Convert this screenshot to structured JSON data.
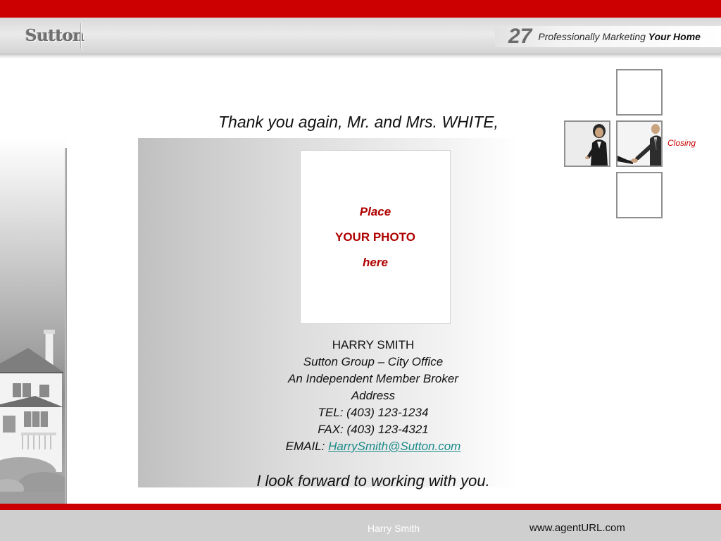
{
  "header": {
    "logo_text": "Sutton",
    "tagline_number": "27",
    "tagline_text": "Professionally Marketing",
    "tagline_bold": "Your Home"
  },
  "slide": {
    "greeting": "Thank you again, Mr. and Mrs. WHITE,",
    "photo_placeholder": {
      "line1": "Place",
      "line2": "YOUR PHOTO",
      "line3": "here"
    },
    "agent": {
      "name": "HARRY SMITH",
      "company": "Sutton Group – City Office",
      "broker": "An Independent Member Broker",
      "address": "Address",
      "tel": "TEL: (403) 123-1234",
      "fax": "FAX: (403) 123-4321",
      "email_label": "EMAIL: ",
      "email": "HarrySmith@Sutton.com"
    },
    "closing": "I look forward to working with you."
  },
  "process_graphic": {
    "step_label": "Closing"
  },
  "footer": {
    "agent_name": "Harry Smith",
    "url": "www.agentURL.com"
  },
  "colors": {
    "brand_red": "#cc0000",
    "placeholder_red": "#b00000",
    "link_teal": "#1a8a8a",
    "header_gray": "#e2e2e2",
    "footer_gray": "#cfcfcf"
  }
}
